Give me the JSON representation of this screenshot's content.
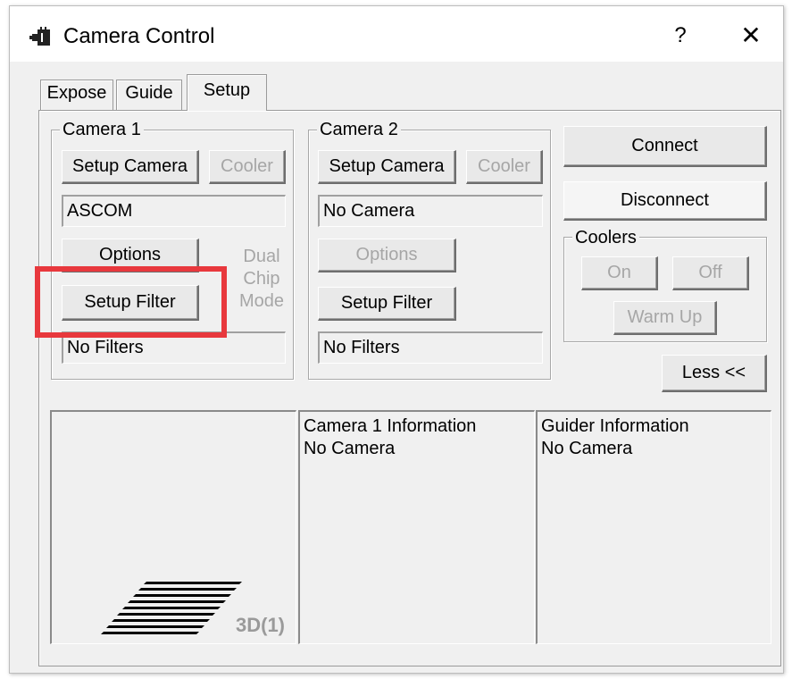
{
  "window": {
    "title": "Camera Control",
    "help_label": "?",
    "close_label": "✕"
  },
  "tabs": [
    {
      "label": "Expose",
      "active": false
    },
    {
      "label": "Guide",
      "active": false
    },
    {
      "label": "Setup",
      "active": true
    }
  ],
  "camera1": {
    "group_label": "Camera 1",
    "setup_camera": "Setup Camera",
    "cooler": "Cooler",
    "camera_name": "ASCOM",
    "options": "Options",
    "setup_filter": "Setup Filter",
    "filter_status": "No Filters",
    "dual_chip": [
      "Dual",
      "Chip",
      "Mode"
    ]
  },
  "camera2": {
    "group_label": "Camera 2",
    "setup_camera": "Setup Camera",
    "cooler": "Cooler",
    "camera_name": "No Camera",
    "options": "Options",
    "setup_filter": "Setup Filter",
    "filter_status": "No Filters"
  },
  "right_panel": {
    "connect": "Connect",
    "disconnect": "Disconnect",
    "coolers_label": "Coolers",
    "on": "On",
    "off": "Off",
    "warm_up": "Warm Up",
    "less": "Less <<"
  },
  "preview": {
    "badge": "3D(1)"
  },
  "info": {
    "camera1_title": "Camera 1 Information",
    "camera1_status": "No Camera",
    "guider_title": "Guider Information",
    "guider_status": "No Camera"
  },
  "colors": {
    "highlight": "#e8383d",
    "disabled_text": "#a6a6a6"
  }
}
